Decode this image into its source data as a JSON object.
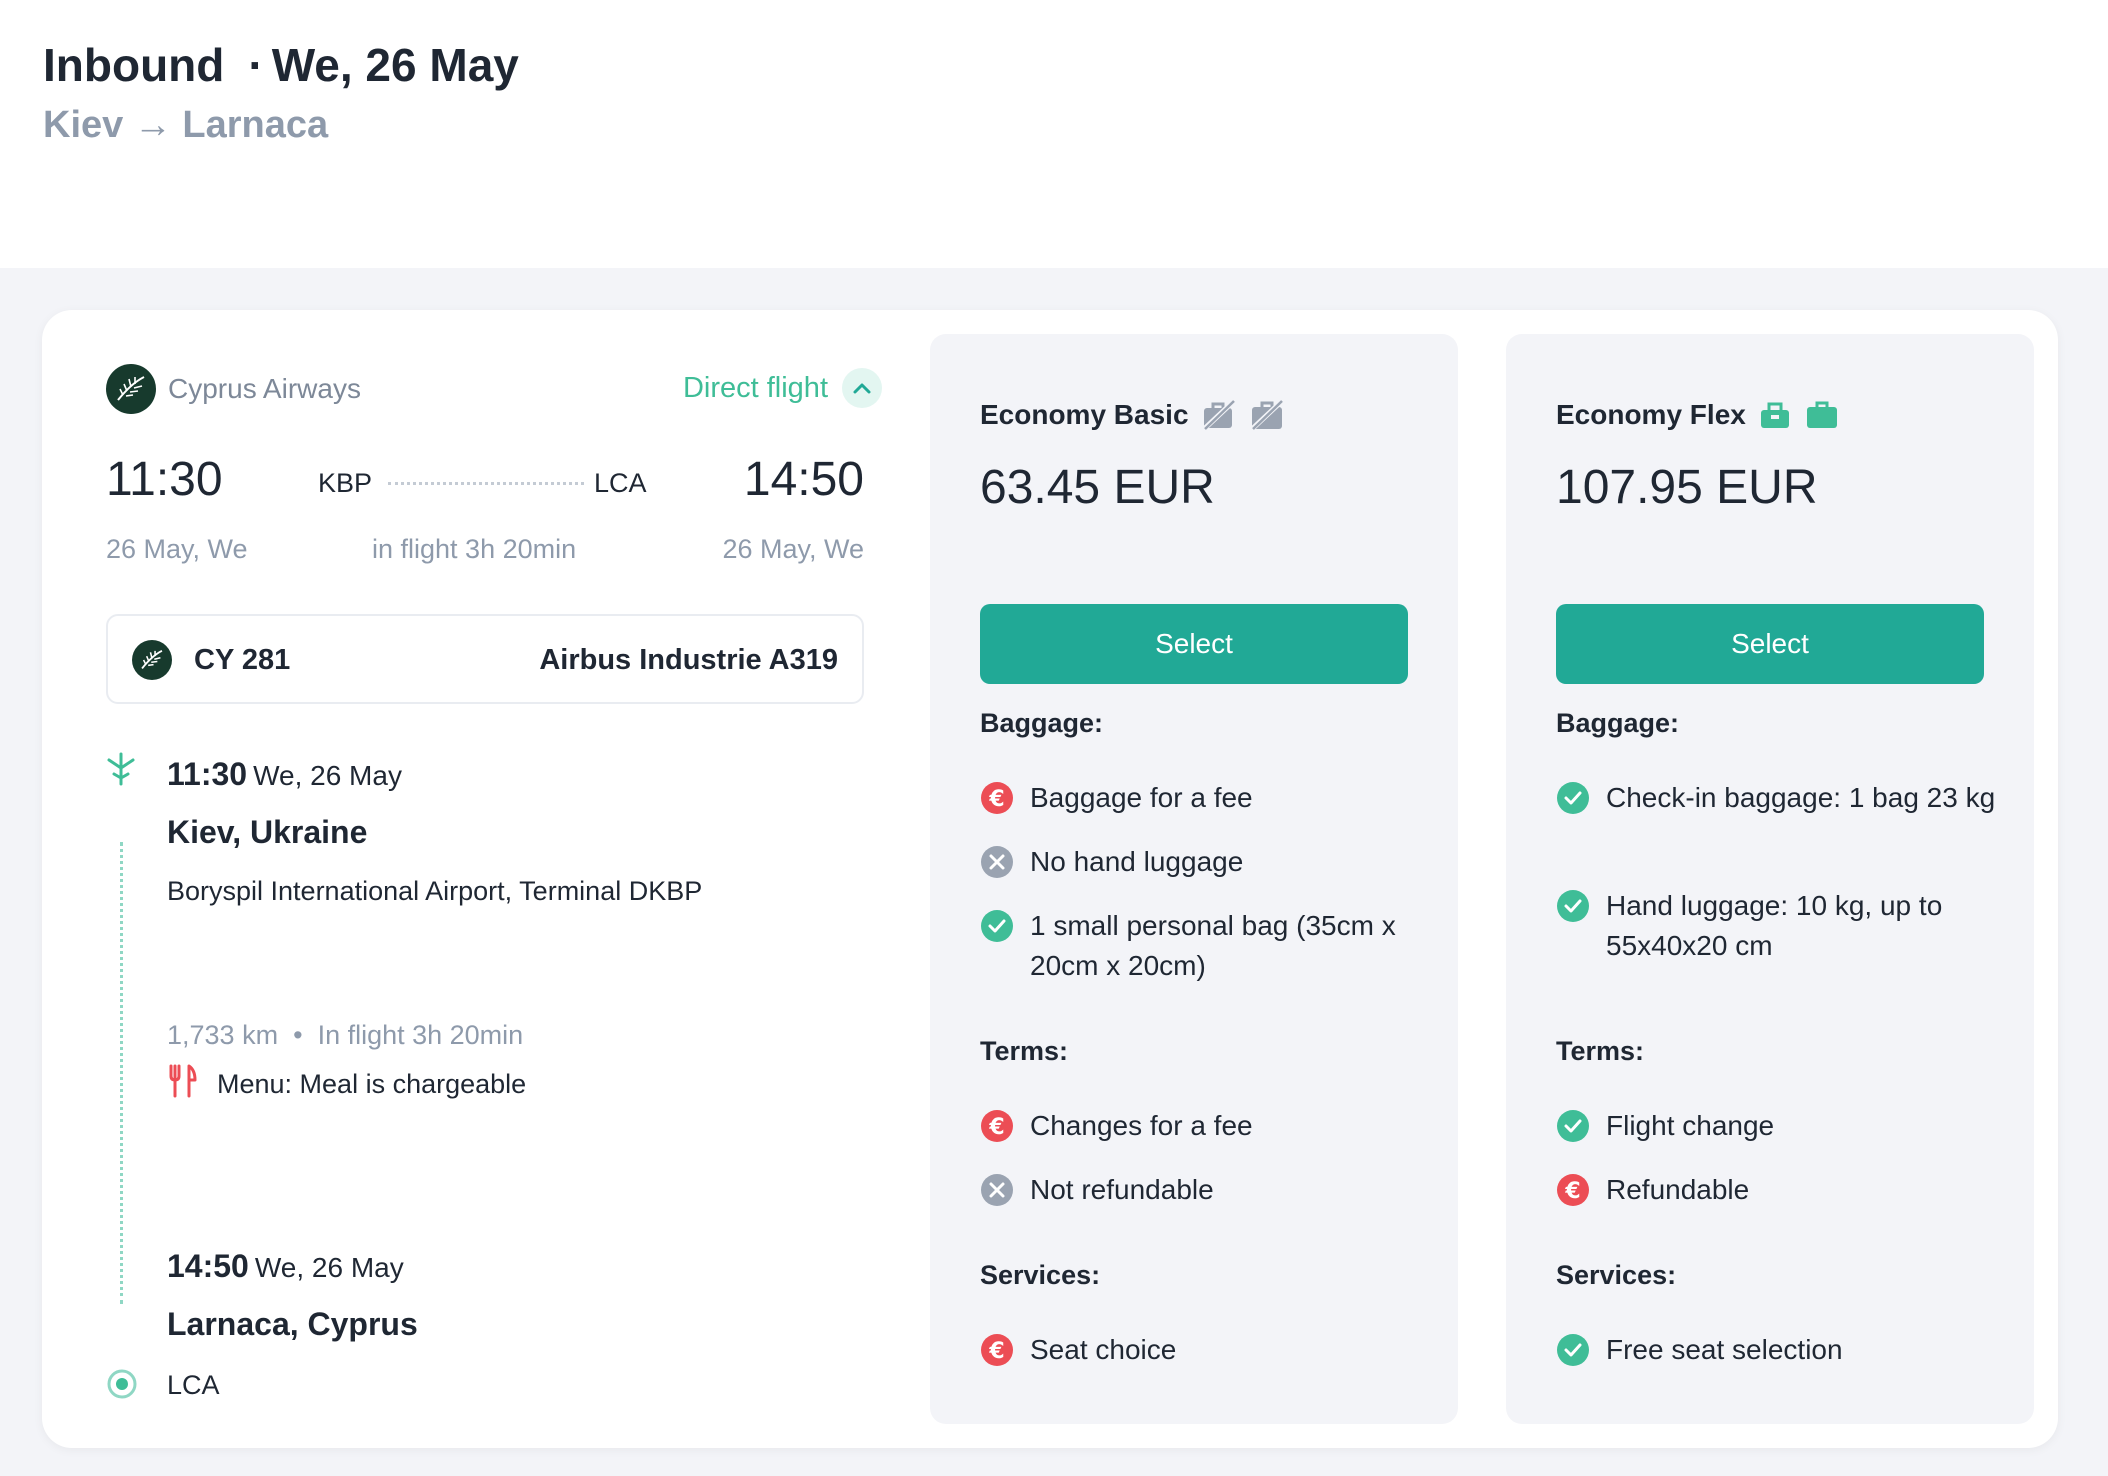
{
  "header": {
    "direction": "Inbound",
    "date": "We, 26 May",
    "route_from": "Kiev",
    "route_to": "Larnaca"
  },
  "flight": {
    "airline": "Cyprus Airways",
    "direct_label": "Direct flight",
    "dep_time": "11:30",
    "arr_time": "14:50",
    "dep_iata": "KBP",
    "arr_iata": "LCA",
    "dep_date": "26 May, We",
    "arr_date": "26 May, We",
    "duration": "in flight 3h 20min",
    "flight_number": "CY 281",
    "aircraft": "Airbus Industrie A319",
    "departure": {
      "time": "11:30",
      "date": "We, 26 May",
      "city": "Kiev, Ukraine",
      "airport": "Boryspil International Airport, Terminal DKBP"
    },
    "distance": "1,733 km",
    "in_flight": "In flight 3h 20min",
    "menu": "Menu: Meal is chargeable",
    "arrival": {
      "time": "14:50",
      "date": "We, 26 May",
      "city": "Larnaca, Cyprus",
      "airport": "LCA"
    }
  },
  "fares": [
    {
      "name": "Economy Basic",
      "price": "63.45 EUR",
      "select_label": "Select",
      "baggage_title": "Baggage:",
      "baggage": [
        {
          "status": "fee",
          "text": "Baggage for a fee"
        },
        {
          "status": "no",
          "text": "No hand luggage"
        },
        {
          "status": "yes",
          "text": "1 small personal bag (35cm x 20cm x 20cm)"
        }
      ],
      "terms_title": "Terms:",
      "terms": [
        {
          "status": "fee",
          "text": "Changes for a fee"
        },
        {
          "status": "no",
          "text": "Not refundable"
        }
      ],
      "services_title": "Services:",
      "services": [
        {
          "status": "fee",
          "text": "Seat choice"
        }
      ]
    },
    {
      "name": "Economy Flex",
      "price": "107.95 EUR",
      "select_label": "Select",
      "baggage_title": "Baggage:",
      "baggage": [
        {
          "status": "yes",
          "text": "Check-in baggage: 1 bag 23 kg"
        },
        {
          "status": "yes",
          "text": "Hand luggage: 10 kg, up to 55x40x20 cm"
        }
      ],
      "terms_title": "Terms:",
      "terms": [
        {
          "status": "yes",
          "text": "Flight change"
        },
        {
          "status": "fee",
          "text": "Refundable"
        }
      ],
      "services_title": "Services:",
      "services": [
        {
          "status": "yes",
          "text": "Free seat selection"
        }
      ]
    }
  ],
  "colors": {
    "accent": "#21a996",
    "fee": "#ec4d55",
    "included": "#3fbd97",
    "excluded": "#9aa3b1"
  }
}
